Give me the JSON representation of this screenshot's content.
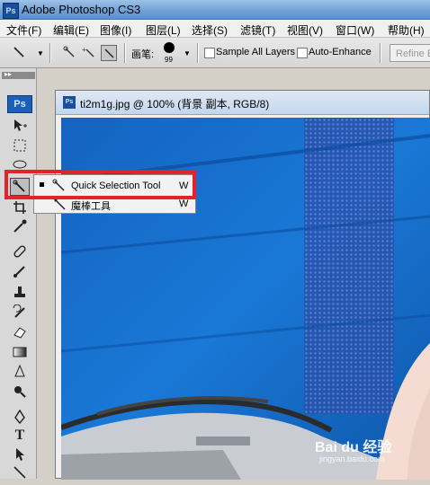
{
  "app": {
    "badge": "Ps",
    "title": "Adobe Photoshop CS3"
  },
  "menu": [
    "文件(F)",
    "编辑(E)",
    "图像(I)",
    "图层(L)",
    "选择(S)",
    "滤镜(T)",
    "视图(V)",
    "窗口(W)",
    "帮助(H)"
  ],
  "options_bar": {
    "brush_label": "画笔:",
    "brush_size": "99",
    "sample_all_layers": "Sample All Layers",
    "auto_enhance": "Auto-Enhance",
    "refine_edge": "Refine E"
  },
  "tool_panel": {
    "logo": "Ps",
    "grip": "▸▸"
  },
  "document": {
    "badge": "Ps",
    "title": "ti2m1g.jpg @ 100% (背景 副本, RGB/8)"
  },
  "flyout": {
    "items": [
      {
        "label": "Quick Selection Tool",
        "shortcut": "W",
        "selected": true,
        "icon": "quick-selection-icon"
      },
      {
        "label": "魔棒工具",
        "shortcut": "W",
        "selected": false,
        "icon": "magic-wand-icon"
      }
    ]
  },
  "watermark": {
    "brand": "Bai du 经验",
    "url": "jingyan.baidu.com"
  },
  "colors": {
    "highlight": "#e3232a",
    "canvas_blue": "#1269c4"
  }
}
